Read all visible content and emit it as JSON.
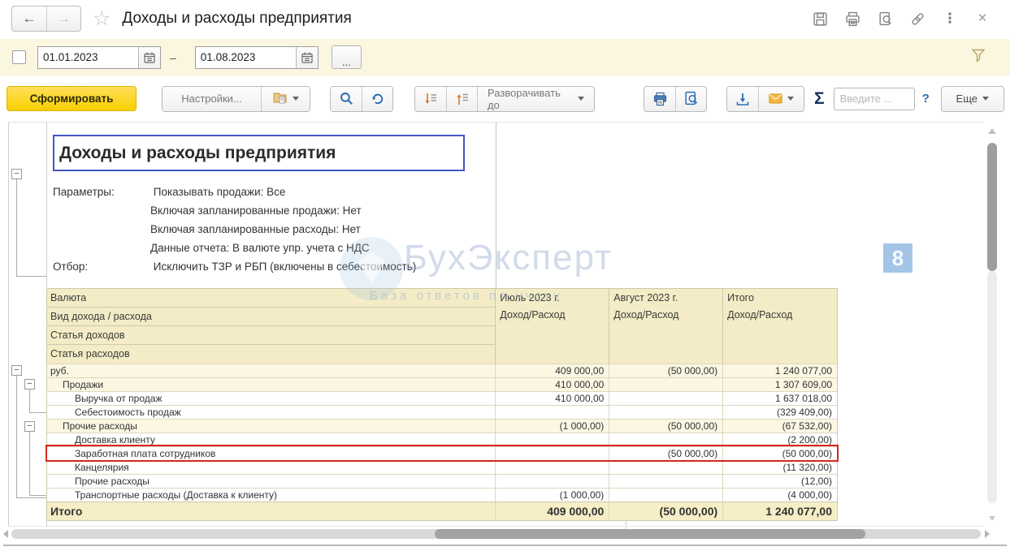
{
  "icons": {
    "back": "←",
    "forward": "→",
    "star": "☆",
    "kebab": "⋮",
    "close": "×",
    "sigma": "Σ",
    "help": "?",
    "dots": "...",
    "dash": "–"
  },
  "header": {
    "title": "Доходы и расходы предприятия"
  },
  "filter": {
    "date_from": "01.01.2023",
    "date_to": "01.08.2023"
  },
  "toolbar": {
    "generate_label": "Сформировать",
    "settings_label": "Настройки...",
    "expand_to_label": "Разворачивать до",
    "search_placeholder": "Введите ...",
    "more_label": "Еще"
  },
  "report": {
    "title": "Доходы и расходы предприятия",
    "params_label": "Параметры:",
    "params": [
      "Показывать продажи: Все",
      "Включая запланированные продажи: Нет",
      "Включая запланированные расходы: Нет",
      "Данные отчета: В валюте упр. учета с НДС"
    ],
    "filter_label": "Отбор:",
    "filter_value": "Исключить ТЗР и РБП (включены в себестоимость)",
    "watermark": {
      "text": "БухЭксперт",
      "badge": "8",
      "subtext": "База ответов по учету"
    }
  },
  "table": {
    "header_rows": [
      "Валюта",
      "Вид дохода / расхода",
      "Статья доходов",
      "Статья расходов"
    ],
    "columns": [
      {
        "label": "Июль 2023 г.",
        "sub": "Доход/Расход"
      },
      {
        "label": "Август 2023 г.",
        "sub": "Доход/Расход"
      },
      {
        "label": "Итого",
        "sub": "Доход/Расход"
      }
    ],
    "rows": [
      {
        "label": "руб.",
        "indent": 0,
        "group": true,
        "jul": "409 000,00",
        "aug": "(50 000,00)",
        "total": "1 240 077,00"
      },
      {
        "label": "Продажи",
        "indent": 1,
        "group": true,
        "jul": "410 000,00",
        "aug": "",
        "total": "1 307 609,00"
      },
      {
        "label": "Выручка от продаж",
        "indent": 2,
        "jul": "410 000,00",
        "aug": "",
        "total": "1 637 018,00"
      },
      {
        "label": "Себестоимость продаж",
        "indent": 2,
        "jul": "",
        "aug": "",
        "total": "(329 409,00)"
      },
      {
        "label": "Прочие расходы",
        "indent": 1,
        "group": true,
        "jul": "(1 000,00)",
        "aug": "(50 000,00)",
        "total": "(67 532,00)"
      },
      {
        "label": "Доставка клиенту",
        "indent": 2,
        "jul": "",
        "aug": "",
        "total": "(2 200,00)"
      },
      {
        "label": "Заработная плата сотрудников",
        "indent": 2,
        "highlight": true,
        "jul": "",
        "aug": "(50 000,00)",
        "total": "(50 000,00)"
      },
      {
        "label": "Канцелярия",
        "indent": 2,
        "jul": "",
        "aug": "",
        "total": "(11 320,00)"
      },
      {
        "label": "Прочие расходы",
        "indent": 2,
        "jul": "",
        "aug": "",
        "total": "(12,00)"
      },
      {
        "label": "Транспортные расходы (Доставка к клиенту)",
        "indent": 2,
        "jul": "(1 000,00)",
        "aug": "",
        "total": "(4 000,00)"
      }
    ],
    "total_row": {
      "label": "Итого",
      "jul": "409 000,00",
      "aug": "(50 000,00)",
      "total": "1 240 077,00"
    }
  },
  "colors": {
    "accent_yellow": "#f7cf00",
    "highlight_red": "#d9261c",
    "report_title_border": "#4256c8",
    "header_beige": "#f3ecc6",
    "watermark_blue": "#5b9bd5"
  }
}
